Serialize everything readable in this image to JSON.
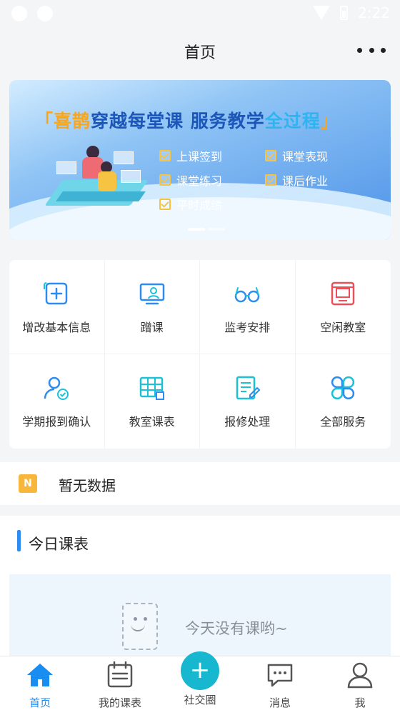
{
  "status_bar": {
    "time": "2:22"
  },
  "header": {
    "title": "首页",
    "more_icon": "more-dots-icon"
  },
  "banner": {
    "headline_prefix": "「",
    "headline_brand": "喜鹊",
    "headline_mid": "穿越每堂课 服务教学",
    "headline_highlight": "全过程",
    "headline_suffix": "」",
    "features": [
      "上课签到",
      "课堂表现",
      "课堂练习",
      "课后作业",
      "平时成绩"
    ]
  },
  "services": [
    {
      "label": "增改基本信息",
      "icon": "plus-square-icon"
    },
    {
      "label": "蹭课",
      "icon": "monitor-user-icon"
    },
    {
      "label": "监考安排",
      "icon": "glasses-icon"
    },
    {
      "label": "空闲教室",
      "icon": "classroom-icon"
    },
    {
      "label": "学期报到确认",
      "icon": "user-check-icon"
    },
    {
      "label": "教室课表",
      "icon": "timetable-icon"
    },
    {
      "label": "报修处理",
      "icon": "repair-form-icon"
    },
    {
      "label": "全部服务",
      "icon": "all-services-icon"
    }
  ],
  "notice": {
    "badge": "N",
    "text": "暂无数据"
  },
  "today": {
    "title": "今日课表",
    "empty_text": "今天没有课哟~"
  },
  "tabbar": {
    "items": [
      {
        "label": "首页",
        "icon": "home-icon"
      },
      {
        "label": "我的课表",
        "icon": "calendar-icon"
      },
      {
        "label": "社交圈",
        "icon": "plus-icon"
      },
      {
        "label": "消息",
        "icon": "message-icon"
      },
      {
        "label": "我",
        "icon": "profile-icon"
      }
    ]
  },
  "colors": {
    "accent": "#1a8df0",
    "teal": "#17b7cf",
    "badge": "#f8b73a"
  }
}
